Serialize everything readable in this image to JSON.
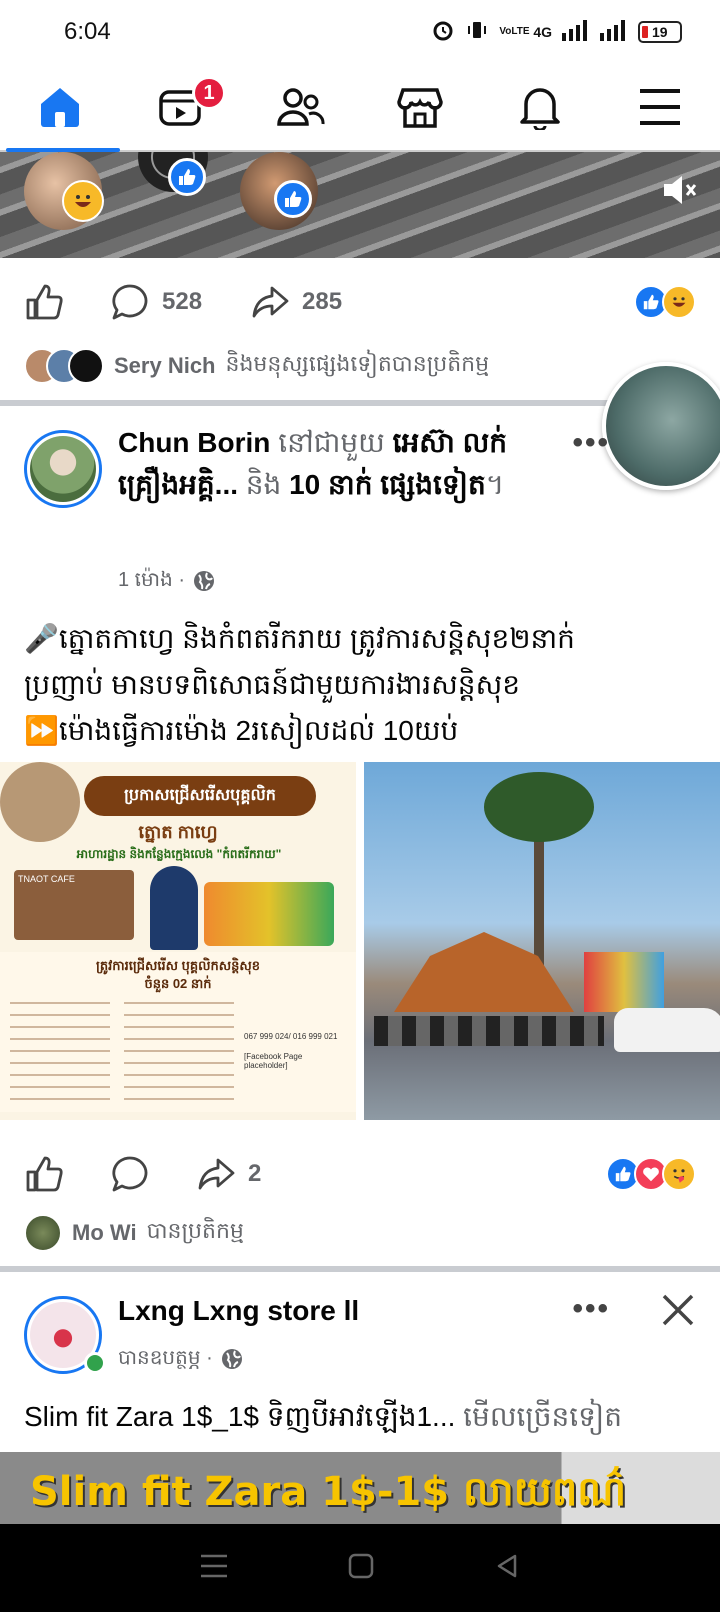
{
  "status": {
    "time": "6:04",
    "network": "4G",
    "lte": "VoLTE",
    "battery": "19"
  },
  "nav": {
    "video_badge": "1"
  },
  "post0": {
    "comments": "528",
    "shares": "285",
    "reactor_name": "Sery Nich",
    "reactor_rest": "និងមនុស្សផ្សេងទៀតបានប្រតិកម្ម"
  },
  "post1": {
    "author": "Chun Borin",
    "with_text": "នៅជាមួយ",
    "tagged": "អេស៊ា លក់គ្រឿងអគ្គិ...",
    "and_text": "និង",
    "others": "10 នាក់ ផ្សេងទៀត",
    "period": "។",
    "time": "1 ម៉ោង ·",
    "text_line1": "🎤ត្នោតកាហ្វេ និងកំពតរីករាយ ត្រូវការសន្តិសុខ២នាក់",
    "text_line2": "ប្រញាប់ មានបទពិសោធន៍ជាមួយការងារសន្តិសុខ",
    "text_line3": "⏩ម៉ោងធ្វើការម៉ោង 2រសៀលដល់ 10យប់",
    "poster_title": "ប្រកាសជ្រើសរើសបុគ្គលិក",
    "poster_brand": "ត្នោត កាហ្វេ",
    "poster_sub": "អាហារដ្ឋាន និងកន្លែងក្មេងលេង \"កំពតរីករាយ\"",
    "poster_need": "ត្រូវការជ្រើសរើស បុគ្គលិកសន្តិសុខ",
    "poster_count": "ចំនួន 02 នាក់",
    "poster_phone": "067 999 024/ 016 999 021",
    "poster_fb": "[Facebook Page placeholder]",
    "tnaot": "TNAOT CAFE",
    "shares": "2",
    "reactor_name": "Mo Wi",
    "reactor_rest": "បានប្រតិកម្ម"
  },
  "post2": {
    "author": "Lxng Lxng store ll",
    "time": "បានឧបត្ថម្ភ ·",
    "text": "Slim fit Zara 1$_1$ ទិញបីអាវឡើង1...",
    "see_more": "មើលច្រើនទៀត",
    "banner": "Slim fit Zara 1$-1$ លាយពណ៌"
  },
  "colors": {
    "accent": "#1877f2",
    "badge": "#e41e3f"
  }
}
